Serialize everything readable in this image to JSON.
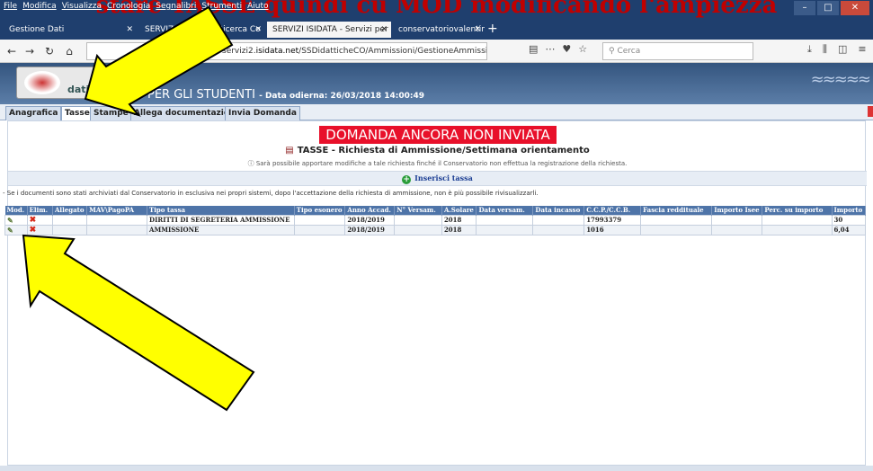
{
  "caption": "stare TASSE quindi cu MOD modificando l'ampiezza",
  "browser": {
    "menu": [
      "File",
      "Modifica",
      "Visualizza",
      "Cronologia",
      "Segnalibri",
      "Strumenti",
      "Aiuto"
    ],
    "tabs": [
      {
        "label": "Gestione Dati",
        "active": false
      },
      {
        "label": "SERVIZI ISIDATA - Ricerca Co",
        "active": false
      },
      {
        "label": "SERVIZI ISIDATA - Servizi per gli st",
        "active": true
      },
      {
        "label": "conservatoriovalentini.it/it/internatio",
        "active": false
      }
    ],
    "url_prefix": "servizi2.",
    "url_domain": "isidata.net",
    "url_path": "/SSDidatticheCO/Ammissioni/GestioneAmmissioni.aspx",
    "search_placeholder": "Cerca"
  },
  "header": {
    "logo_text": "dati",
    "title": "PER GLI STUDENTI",
    "date_label": "- Data odierna: 26/03/2018 14:00:49"
  },
  "page_tabs": [
    "Anagrafica",
    "Tasse",
    "Stampe",
    "Allega documentazione",
    "Invia Domanda"
  ],
  "banner": "DOMANDA ANCORA NON INVIATA",
  "section_title": "TASSE - Richiesta di Ammissione/Settimana orientamento",
  "note": "Sarà possibile apportare modifiche a tale richiesta finché il Conservatorio non effettua la registrazione della richiesta.",
  "insert_label": "Inserisci tassa",
  "info": "- Se i documenti sono stati archiviati dal Conservatorio in esclusiva nei propri sistemi, dopo l'accettazione della richiesta di ammissione, non è più possibile rivisualizzarli.",
  "table": {
    "headers": [
      "Mod.",
      "Elim.",
      "Allegato",
      "MAV\\PagoPA",
      "Tipo tassa",
      "Tipo esonero",
      "Anno Accad.",
      "N° Versam.",
      "A.Solare",
      "Data versam.",
      "Data incasso",
      "C.C.P./C.C.B.",
      "Fascia reddituale",
      "Importo Isee",
      "Perc. su importo",
      "Importo"
    ],
    "rows": [
      [
        "",
        "",
        "",
        "",
        "DIRITTI DI SEGRETERIA AMMISSIONE",
        "",
        "2018/2019",
        "",
        "2018",
        "",
        "",
        "17993379",
        "",
        "",
        "",
        "30"
      ],
      [
        "",
        "",
        "",
        "",
        "AMMISSIONE",
        "",
        "2018/2019",
        "",
        "2018",
        "",
        "",
        "1016",
        "",
        "",
        "",
        "6,04"
      ]
    ]
  },
  "colors": {
    "banner": "#e8102a",
    "header": "#34557f",
    "arrow": "#ffff00"
  },
  "icons": {
    "edit": "edit-icon",
    "delete": "delete-icon",
    "add": "add-circle-icon"
  }
}
